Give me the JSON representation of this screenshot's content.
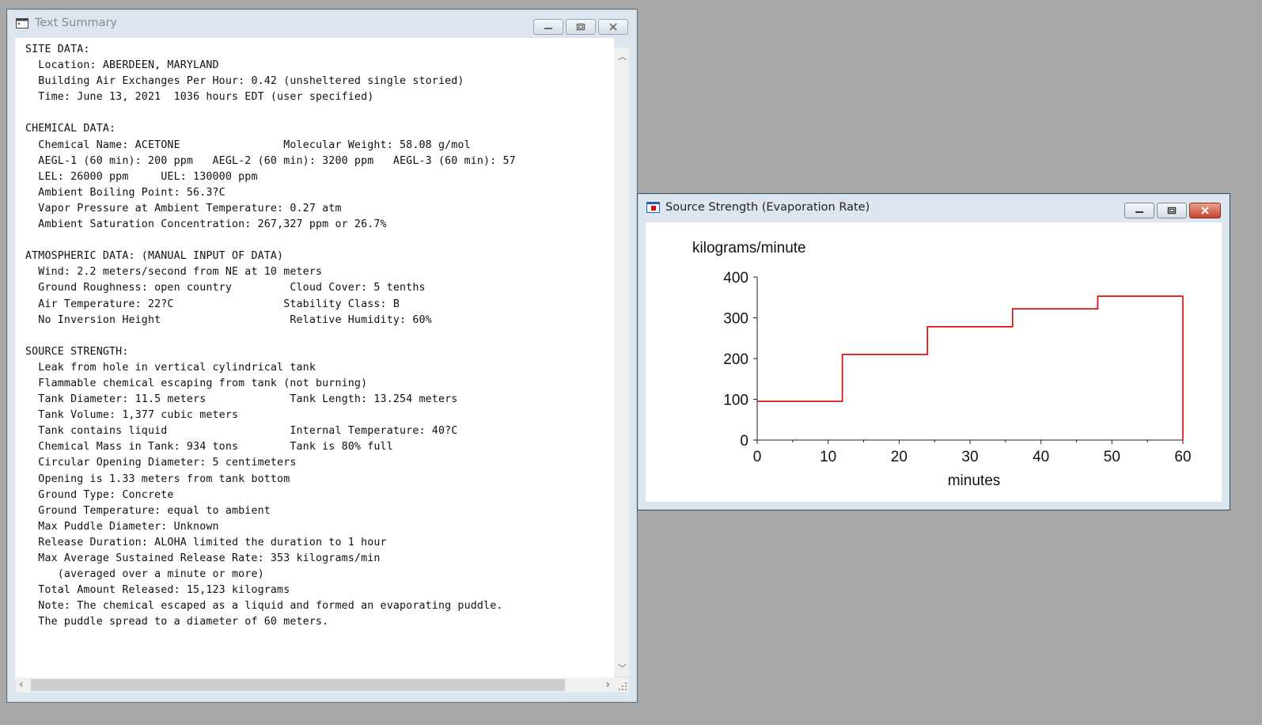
{
  "text_summary": {
    "title": "Text Summary",
    "lines": [
      "SITE DATA:",
      "  Location: ABERDEEN, MARYLAND",
      "  Building Air Exchanges Per Hour: 0.42 (unsheltered single storied)",
      "  Time: June 13, 2021  1036 hours EDT (user specified)",
      "",
      "CHEMICAL DATA:",
      "  Chemical Name: ACETONE                Molecular Weight: 58.08 g/mol",
      "  AEGL-1 (60 min): 200 ppm   AEGL-2 (60 min): 3200 ppm   AEGL-3 (60 min): 57",
      "  LEL: 26000 ppm     UEL: 130000 ppm",
      "  Ambient Boiling Point: 56.3?C",
      "  Vapor Pressure at Ambient Temperature: 0.27 atm",
      "  Ambient Saturation Concentration: 267,327 ppm or 26.7%",
      "",
      "ATMOSPHERIC DATA: (MANUAL INPUT OF DATA)",
      "  Wind: 2.2 meters/second from NE at 10 meters",
      "  Ground Roughness: open country         Cloud Cover: 5 tenths",
      "  Air Temperature: 22?C                 Stability Class: B",
      "  No Inversion Height                    Relative Humidity: 60%",
      "",
      "SOURCE STRENGTH:",
      "  Leak from hole in vertical cylindrical tank",
      "  Flammable chemical escaping from tank (not burning)",
      "  Tank Diameter: 11.5 meters             Tank Length: 13.254 meters",
      "  Tank Volume: 1,377 cubic meters",
      "  Tank contains liquid                   Internal Temperature: 40?C",
      "  Chemical Mass in Tank: 934 tons        Tank is 80% full",
      "  Circular Opening Diameter: 5 centimeters",
      "  Opening is 1.33 meters from tank bottom",
      "  Ground Type: Concrete",
      "  Ground Temperature: equal to ambient",
      "  Max Puddle Diameter: Unknown",
      "  Release Duration: ALOHA limited the duration to 1 hour",
      "  Max Average Sustained Release Rate: 353 kilograms/min",
      "     (averaged over a minute or more)",
      "  Total Amount Released: 15,123 kilograms",
      "  Note: The chemical escaped as a liquid and formed an evaporating puddle.",
      "  The puddle spread to a diameter of 60 meters."
    ]
  },
  "source_strength": {
    "title": "Source Strength (Evaporation Rate)"
  },
  "chart_data": {
    "type": "line",
    "title": "",
    "ylabel": "kilograms/minute",
    "xlabel": "minutes",
    "xlim": [
      0,
      60
    ],
    "ylim": [
      0,
      400
    ],
    "xticks": [
      0,
      10,
      20,
      30,
      40,
      50,
      60
    ],
    "yticks": [
      0,
      100,
      200,
      300,
      400
    ],
    "step_series": {
      "x": [
        0,
        12,
        12,
        24,
        24,
        36,
        36,
        48,
        48,
        60,
        60
      ],
      "y": [
        95,
        95,
        210,
        210,
        278,
        278,
        322,
        322,
        353,
        353,
        0
      ]
    },
    "line_color": "#e00000"
  }
}
